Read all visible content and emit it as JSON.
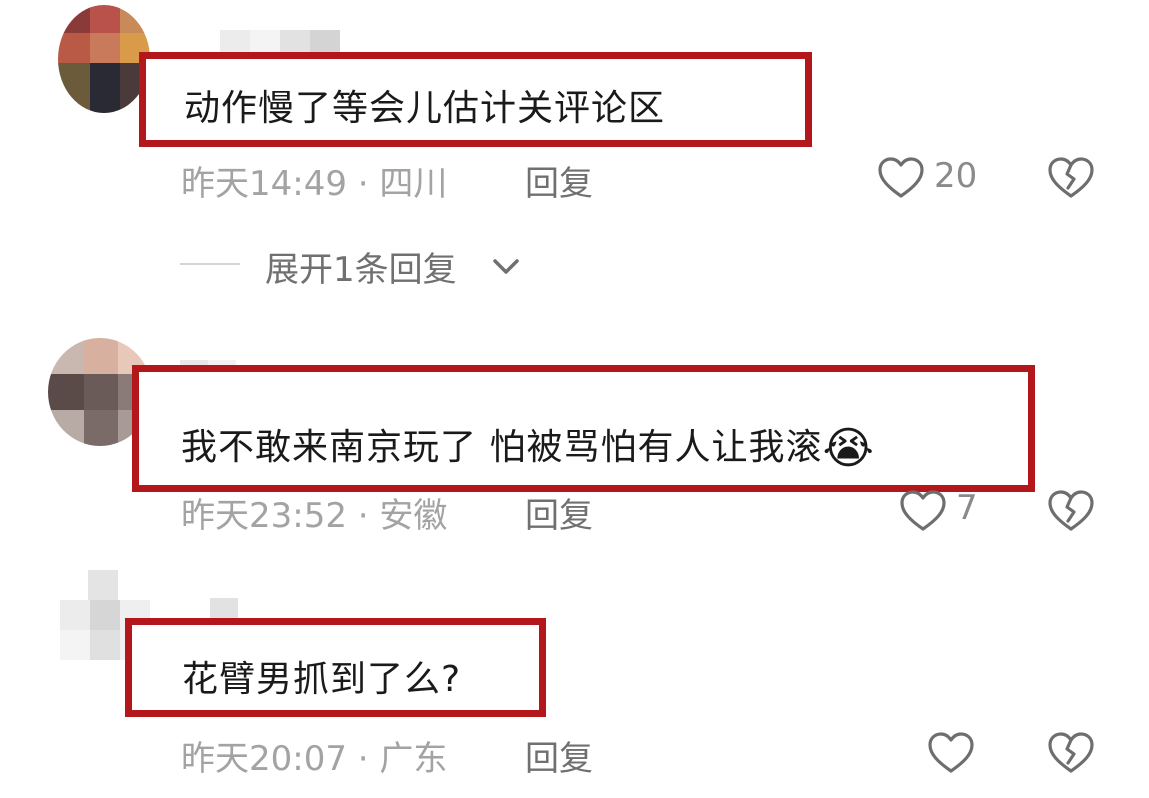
{
  "comments": [
    {
      "text": "动作慢了等会儿估计关评论区",
      "time_location": "昨天14:49 · 四川",
      "reply_label": "回复",
      "likes": "20",
      "expand_label": "展开1条回复"
    },
    {
      "text": "我不敢来南京玩了 怕被骂怕有人让我滚",
      "emoji": "😭",
      "time_location": "昨天23:52 · 安徽",
      "reply_label": "回复",
      "likes": "7"
    },
    {
      "text": "花臂男抓到了么?",
      "time_location": "昨天20:07 · 广东",
      "reply_label": "回复",
      "likes": ""
    }
  ],
  "icons": {
    "like": "heart-outline-icon",
    "dislike": "broken-heart-icon",
    "expand": "chevron-down-icon"
  },
  "colors": {
    "highlight_border": "#b3161b",
    "meta_text": "#a3a3a3",
    "reply_text": "#707070"
  }
}
